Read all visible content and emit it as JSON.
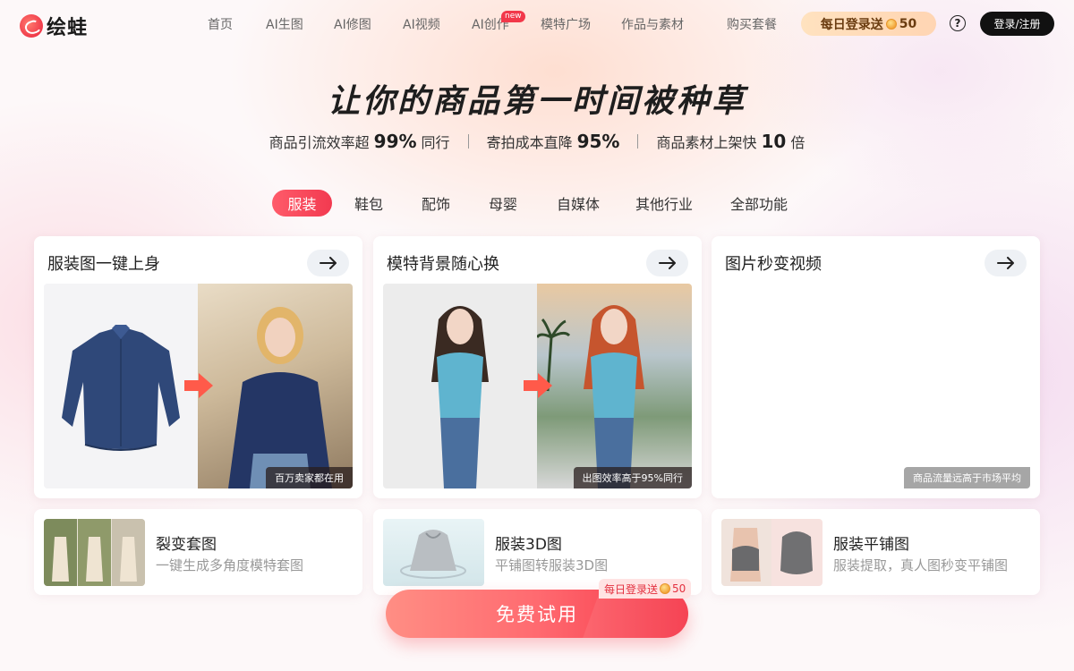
{
  "brand": {
    "name": "绘蛙"
  },
  "nav": {
    "items": [
      "首页",
      "AI生图",
      "AI修图",
      "AI视频",
      "AI创作",
      "模特广场",
      "作品与素材",
      "购买套餐"
    ],
    "new_badge": "new"
  },
  "header": {
    "daily_login_label": "每日登录送",
    "daily_login_amount": "50",
    "help_symbol": "?",
    "login_label": "登录/注册"
  },
  "hero": {
    "title": "让你的商品第一时间被种草",
    "stats": [
      {
        "prefix": "商品引流效率超",
        "value": "99%",
        "suffix": "同行"
      },
      {
        "prefix": "寄拍成本直降",
        "value": "95%",
        "suffix": ""
      },
      {
        "prefix": "商品素材上架快",
        "value": "10",
        "suffix": "倍"
      }
    ]
  },
  "categories": {
    "tabs": [
      "服装",
      "鞋包",
      "配饰",
      "母婴",
      "自媒体",
      "其他行业",
      "全部功能"
    ],
    "active_index": 0
  },
  "feature_cards": [
    {
      "title": "服装图一键上身",
      "badge": "百万卖家都在用"
    },
    {
      "title": "模特背景随心换",
      "badge": "出图效率高于95%同行"
    },
    {
      "title": "图片秒变视频",
      "badge": "商品流量远高于市场平均"
    }
  ],
  "mini_cards": [
    {
      "title": "裂变套图",
      "subtitle": "一键生成多角度模特套图"
    },
    {
      "title": "服装3D图",
      "subtitle": "平铺图转服装3D图"
    },
    {
      "title": "服装平铺图",
      "subtitle": "服装提取，真人图秒变平铺图"
    }
  ],
  "cta": {
    "label": "免费试用",
    "badge_label": "每日登录送",
    "badge_amount": "50"
  },
  "colors": {
    "accent": "#f23a50",
    "coin": "#f2a53a",
    "dark_button": "#111111"
  }
}
